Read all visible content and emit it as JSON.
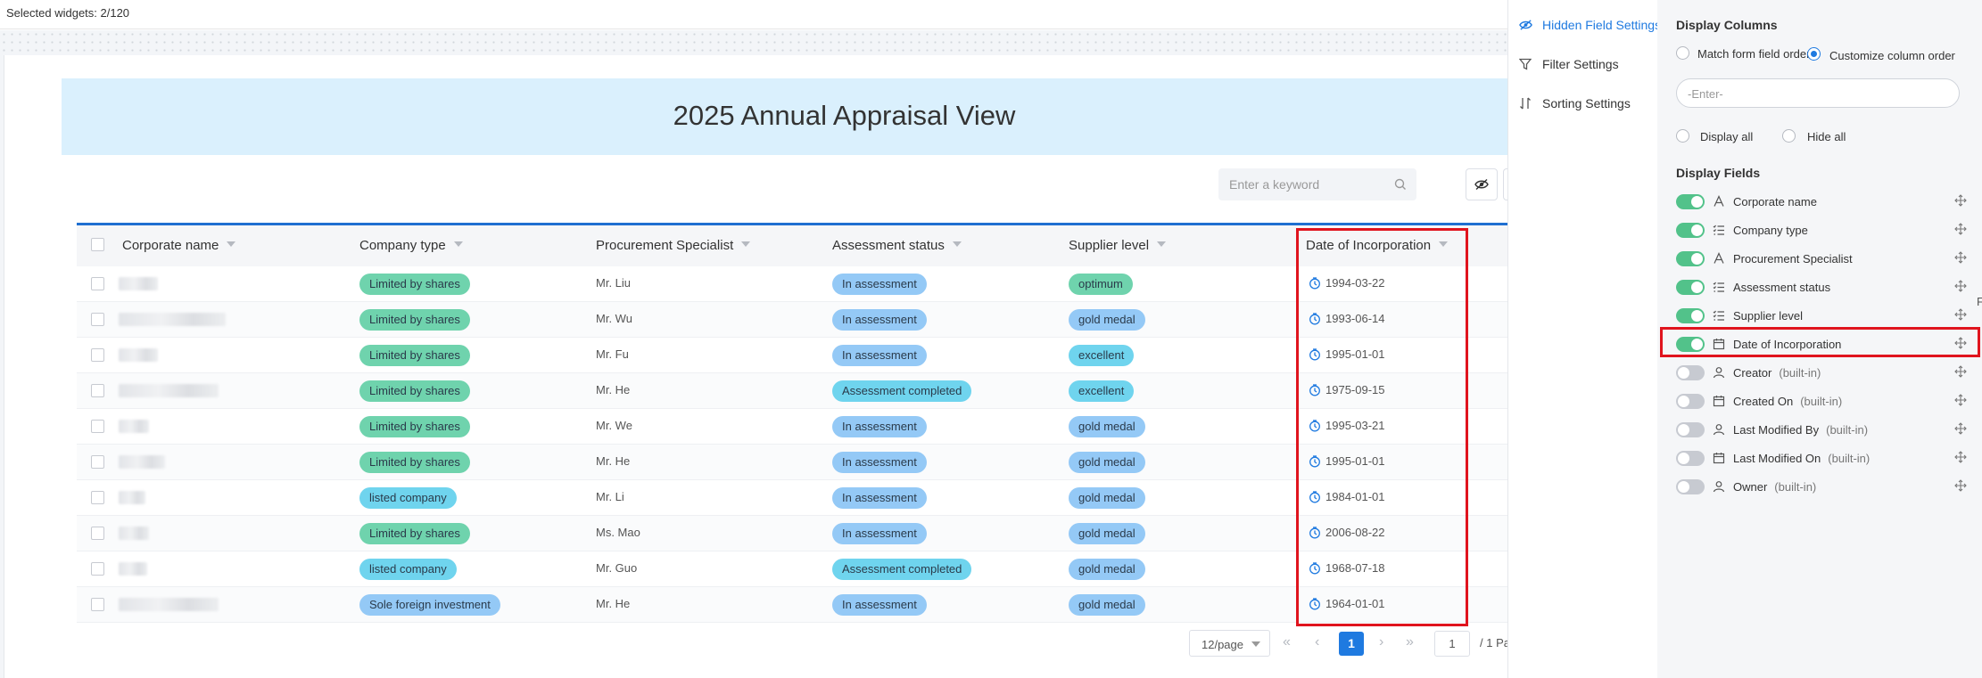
{
  "topbar": {
    "selected_widgets": "Selected widgets: 2/120"
  },
  "view": {
    "title": "2025 Annual Appraisal View"
  },
  "toolbar": {
    "search_placeholder": "Enter a keyword"
  },
  "table": {
    "columns": [
      "Corporate name",
      "Company type",
      "Procurement Specialist",
      "Assessment status",
      "Supplier level",
      "Date of Incorporation"
    ],
    "rows": [
      {
        "company_type": "Limited by shares",
        "specialist": "Mr. Liu",
        "status": "In assessment",
        "level": "optimum",
        "date": "1994-03-22"
      },
      {
        "company_type": "Limited by shares",
        "specialist": "Mr. Wu",
        "status": "In assessment",
        "level": "gold medal",
        "date": "1993-06-14"
      },
      {
        "company_type": "Limited by shares",
        "specialist": "Mr. Fu",
        "status": "In assessment",
        "level": "excellent",
        "date": "1995-01-01"
      },
      {
        "company_type": "Limited by shares",
        "specialist": "Mr. He",
        "status": "Assessment completed",
        "level": "excellent",
        "date": "1975-09-15"
      },
      {
        "company_type": "Limited by shares",
        "specialist": "Mr. We",
        "status": "In assessment",
        "level": "gold medal",
        "date": "1995-03-21"
      },
      {
        "company_type": "Limited by shares",
        "specialist": "Mr. He",
        "status": "In assessment",
        "level": "gold medal",
        "date": "1995-01-01"
      },
      {
        "company_type": "listed company",
        "specialist": "Mr. Li",
        "status": "In assessment",
        "level": "gold medal",
        "date": "1984-01-01"
      },
      {
        "company_type": "Limited by shares",
        "specialist": "Ms. Mao",
        "status": "In assessment",
        "level": "gold medal",
        "date": "2006-08-22"
      },
      {
        "company_type": "listed company",
        "specialist": "Mr. Guo",
        "status": "Assessment completed",
        "level": "gold medal",
        "date": "1968-07-18"
      },
      {
        "company_type": "Sole foreign investment",
        "specialist": "Mr. He",
        "status": "In assessment",
        "level": "gold medal",
        "date": "1964-01-01"
      }
    ]
  },
  "pagination": {
    "page_size": "12/page",
    "current": "1",
    "jump": "1",
    "total": "/ 1 Pa"
  },
  "sidenav": {
    "items": [
      {
        "label": "Hidden Field Settings",
        "icon": "eye-off-icon",
        "active": true
      },
      {
        "label": "Filter Settings",
        "icon": "filter-icon",
        "active": false
      },
      {
        "label": "Sorting Settings",
        "icon": "sort-icon",
        "active": false
      }
    ]
  },
  "panel": {
    "display_columns_heading": "Display Columns",
    "match_order": "Match form field order",
    "custom_order": "Customize column order",
    "enter_placeholder": "-Enter-",
    "display_all": "Display all",
    "hide_all": "Hide all",
    "display_fields_heading": "Display Fields",
    "builtin_tag": "(built-in)",
    "fields": [
      {
        "label": "Corporate name",
        "icon": "text-icon",
        "on": true,
        "builtin": false
      },
      {
        "label": "Company type",
        "icon": "list-icon",
        "on": true,
        "builtin": false
      },
      {
        "label": "Procurement Specialist",
        "icon": "text-icon",
        "on": true,
        "builtin": false
      },
      {
        "label": "Assessment status",
        "icon": "list-icon",
        "on": true,
        "builtin": false
      },
      {
        "label": "Supplier level",
        "icon": "list-icon",
        "on": true,
        "builtin": false
      },
      {
        "label": "Date of Incorporation",
        "icon": "calendar-icon",
        "on": true,
        "builtin": false
      },
      {
        "label": "Creator",
        "icon": "user-icon",
        "on": false,
        "builtin": true
      },
      {
        "label": "Created On",
        "icon": "calendar-icon",
        "on": false,
        "builtin": true
      },
      {
        "label": "Last Modified By",
        "icon": "user-icon",
        "on": false,
        "builtin": true
      },
      {
        "label": "Last Modified On",
        "icon": "calendar-icon",
        "on": false,
        "builtin": true
      },
      {
        "label": "Owner",
        "icon": "user-icon",
        "on": false,
        "builtin": true
      }
    ],
    "edge_fragment": "F"
  },
  "colors": {
    "accent": "#1f7ae0",
    "highlight": "#e0141e",
    "toggle_on": "#52c28a",
    "banner": "#daf0fd"
  }
}
